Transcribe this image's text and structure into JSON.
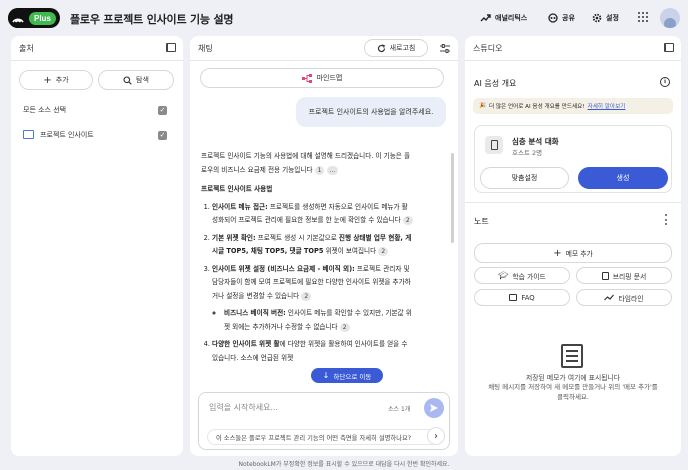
{
  "header": {
    "logo_badge": "Plus",
    "title": "플로우 프로젝트 인사이트 기능 설명",
    "analytics_label": "애널리틱스",
    "share_label": "공유",
    "settings_label": "설정"
  },
  "sources": {
    "title": "출처",
    "add_label": "추가",
    "explore_label": "탐색",
    "select_all_label": "모든 소스 선택",
    "items": [
      {
        "label": "프로젝트 인사이트"
      }
    ]
  },
  "chat": {
    "title": "채팅",
    "refresh_label": "새로고침",
    "mindmap_label": "마인드맵",
    "user_message": "프로젝트 인사이트의 사용법을 알려주세요.",
    "answer": {
      "intro": "프로젝트 인사이트 기능의 사용법에 대해 설명해 드리겠습니다. 이 기능은 플로우의 비즈니스 요금제 전용 기능입니다",
      "intro_cite": "1",
      "intro_more": "...",
      "heading": "프로젝트 인사이트 사용법",
      "items": [
        {
          "bold": "인사이트 메뉴 접근:",
          "text": " 프로젝트를 생성하면 자동으로 인사이트 메뉴가 활성화되어 프로젝트 관리에 필요한 정보를 한 눈에 확인할 수 있습니다",
          "cite": "2"
        },
        {
          "bold": "기본 위젯 확인:",
          "text": " 프로젝트 생성 시 기본값으로 ",
          "bold2": "진행 상태별 업무 현황, 게시글 TOP5, 채팅 TOP5, 댓글 TOP5",
          "text2": " 위젯이 보여집니다",
          "cite": "2"
        },
        {
          "bold": "인사이트 위젯 설정 (비즈니스 요금제 - 베이직 외):",
          "text": " 프로젝트 관리자 및 담당자들이 함께 모여 프로젝트에 필요한 다양한 인사이트 위젯을 추가하거나 설정을 변경할 수 있습니다",
          "cite": "2",
          "sub_bold": "비즈니스 베이직 버전:",
          "sub_text": " 인사이트 메뉴를 확인할 수 있지만, 기본값 위젯 외에는 추가하거나 수정할 수 없습니다",
          "sub_cite": "2"
        },
        {
          "bold": "다양한 인사이트 위젯 활",
          "text": "에 다양한 위젯을 활용하여 인사이트를 얻을 수 있습니다. 소스에 언급된 위젯"
        }
      ]
    },
    "scroll_down_label": "하단으로 이동",
    "input_placeholder": "입력을 시작하세요...",
    "source_count": "소스 1개",
    "suggestion": "이 소스들은 플로우 프로젝트 관리 기능의 어떤 측면을 자세히 설명하나요?",
    "footer": "NotebookLM가 부정확한 정보를 표시할 수 있으므로 대답을 다시 한번 확인하세요."
  },
  "studio": {
    "title": "스튜디오",
    "audio_overview_title": "AI 음성 개요",
    "lang_banner": "더 많은 언어로 AI 음성 개요를 만드세요!",
    "lang_banner_link": "자세히 알아보기",
    "card_title": "심층 분석 대화",
    "card_subtitle": "호스트 2명",
    "customize_label": "맞춤설정",
    "generate_label": "생성",
    "notes_title": "노트",
    "add_note_label": "메모 추가",
    "study_guide_label": "학습 가이드",
    "briefing_label": "브리핑 문서",
    "faq_label": "FAQ",
    "timeline_label": "타임라인",
    "empty_title": "저장된 메모가 여기에 표시됩니다",
    "empty_desc": "채팅 메시지를 저장하여 새 메모를 만들거나 위의 '메모 추가'를 클릭하세요."
  },
  "colors": {
    "accent": "#3b5bd6",
    "badge": "#3fb950",
    "background": "#eef0f6"
  }
}
